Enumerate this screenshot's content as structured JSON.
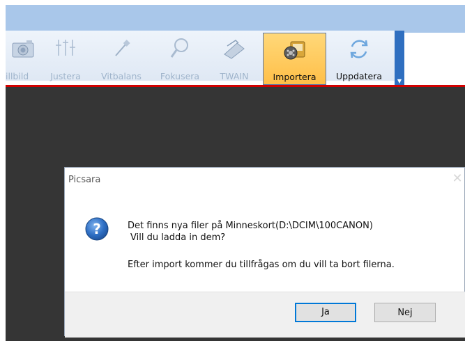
{
  "toolbar": {
    "items": [
      {
        "label": "illbild",
        "icon": "camera-icon",
        "enabled": false
      },
      {
        "label": "Justera",
        "icon": "sliders-icon",
        "enabled": false
      },
      {
        "label": "Vitbalans",
        "icon": "eyedropper-icon",
        "enabled": false
      },
      {
        "label": "Fokusera",
        "icon": "magnifier-icon",
        "enabled": false
      },
      {
        "label": "TWAIN",
        "icon": "scanner-icon",
        "enabled": false
      },
      {
        "label": "Importera",
        "icon": "import-folder-icon",
        "enabled": true,
        "selected": true
      },
      {
        "label": "Uppdatera",
        "icon": "refresh-icon",
        "enabled": true
      }
    ],
    "expand_icon": "dropdown-arrow-icon"
  },
  "dialog": {
    "title": "Picsara",
    "icon": "question-icon",
    "message_line1": "Det finns nya filer på Minneskort(D:\\DCIM\\100CANON)",
    "message_line2": "Vill du ladda in dem?",
    "message_line3": "Efter import kommer du tillfrågas om du vill ta bort filerna.",
    "yes_label": "Ja",
    "no_label": "Nej"
  },
  "colors": {
    "accent_red": "#d20000",
    "ribbon_blue": "#2f6fc0",
    "workspace": "#353535",
    "default_button_border": "#0078d7"
  }
}
